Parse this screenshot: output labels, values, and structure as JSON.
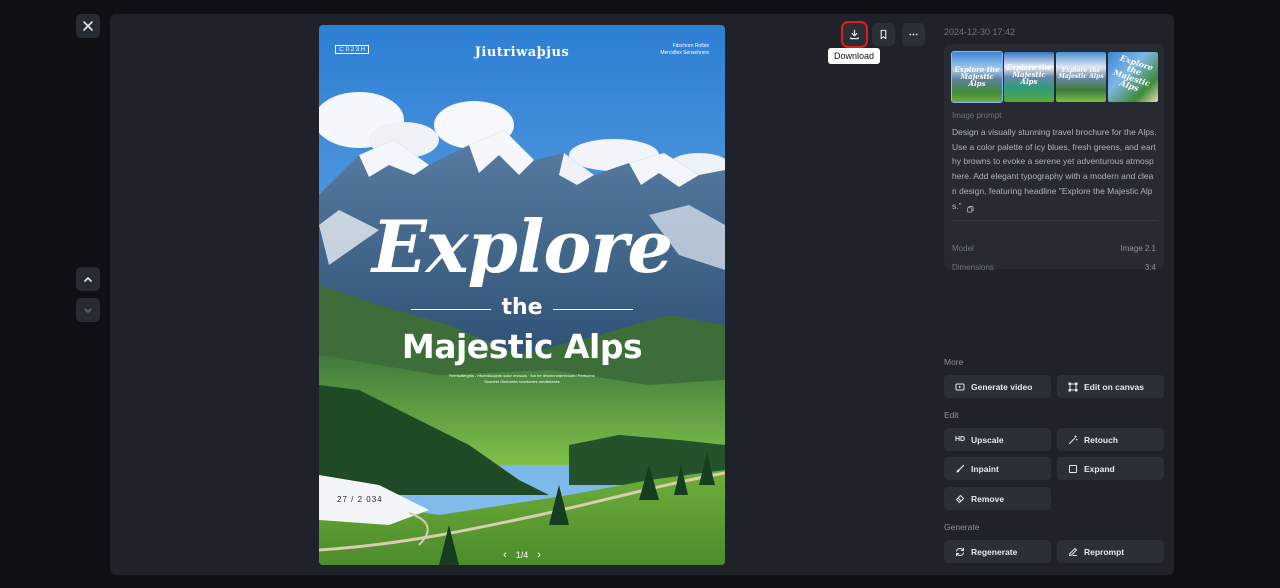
{
  "window": {
    "close_label": "close"
  },
  "poster": {
    "brand": "Jiutriwaþjus",
    "tag_left": "⊏ 0 2 3 H",
    "tag_right": "Fäschorn Rolbie Mercidlex Sensehrere",
    "headline_line1": "Explore",
    "headline_line2": "the",
    "headline_line3": "Majestic Alps",
    "fine_print_1": "Remsdtergnis - rrtuentiuuqnte sulor nnouuis · fun ter drtonnnearreccueo Pereuens",
    "fine_print_2": "Susrteel Gtelonrea roodiurdes untdsteroes",
    "date_mark": "27 / 2 034",
    "pager": {
      "prev": "‹",
      "label": "1/4",
      "next": "›"
    }
  },
  "actions": {
    "tooltip": "Download"
  },
  "details": {
    "timestamp": "2024-12-30 17:42",
    "thumbnails": [
      {
        "caption": "Explore the Majestic Alps"
      },
      {
        "caption": "Explore the Majestic Alps"
      },
      {
        "caption": "Explore the Majestic Alps"
      },
      {
        "caption": "Explore the Majestic Alps"
      }
    ],
    "prompt_label": "Image prompt",
    "prompt_text": "Design a visually stunning travel brochure for the Alps. Use a color palette of icy blues, fresh greens, and earthy browns to evoke a serene yet adventurous atmosphere. Add elegant typography with a modern and clean design, featuring headline \"Explore the Majestic Alps.\"",
    "copy_icon": "copy-icon",
    "model_label": "Model",
    "model_value": "Image 2.1",
    "dimensions_label": "Dimensions",
    "dimensions_value": "3:4"
  },
  "sections": {
    "more_label": "More",
    "edit_label": "Edit",
    "generate_label": "Generate"
  },
  "tools": {
    "generate_video": "Generate video",
    "edit_on_canvas": "Edit on canvas",
    "upscale_badge": "HD",
    "upscale": "Upscale",
    "retouch": "Retouch",
    "inpaint": "Inpaint",
    "expand": "Expand",
    "remove": "Remove",
    "regenerate": "Regenerate",
    "reprompt": "Reprompt"
  },
  "colors": {
    "background": "#0e1013",
    "panel": "#1f2228",
    "button": "#2b2f36",
    "highlight": "#e01c22"
  }
}
